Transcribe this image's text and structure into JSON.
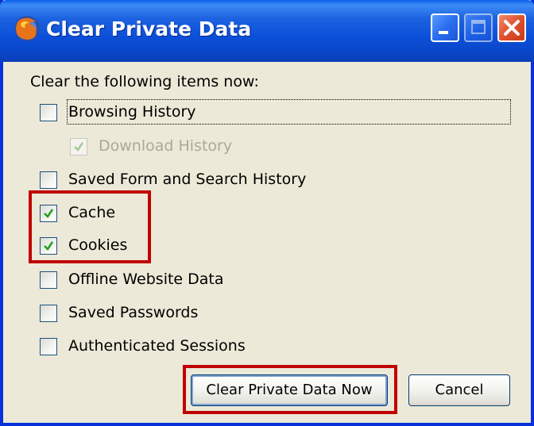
{
  "window": {
    "title": "Clear Private Data",
    "icon": "firefox-icon",
    "controls": [
      "minimize-icon",
      "maximize-icon",
      "close-icon"
    ],
    "accent_color": "#0a46c8",
    "close_color": "#e0502e"
  },
  "dialog": {
    "instruction": "Clear the following items now:",
    "items": [
      {
        "label": "Browsing History",
        "checked": false,
        "enabled": true,
        "focused": true
      },
      {
        "label": "Download History",
        "checked": true,
        "enabled": false
      },
      {
        "label": "Saved Form and Search History",
        "checked": false,
        "enabled": true
      },
      {
        "label": "Cache",
        "checked": true,
        "enabled": true
      },
      {
        "label": "Cookies",
        "checked": true,
        "enabled": true
      },
      {
        "label": "Offline Website Data",
        "checked": false,
        "enabled": true
      },
      {
        "label": "Saved Passwords",
        "checked": false,
        "enabled": true
      },
      {
        "label": "Authenticated Sessions",
        "checked": false,
        "enabled": true
      }
    ],
    "highlight_color": "#c00000"
  },
  "buttons": {
    "clear_now": "Clear Private Data Now",
    "cancel": "Cancel"
  }
}
